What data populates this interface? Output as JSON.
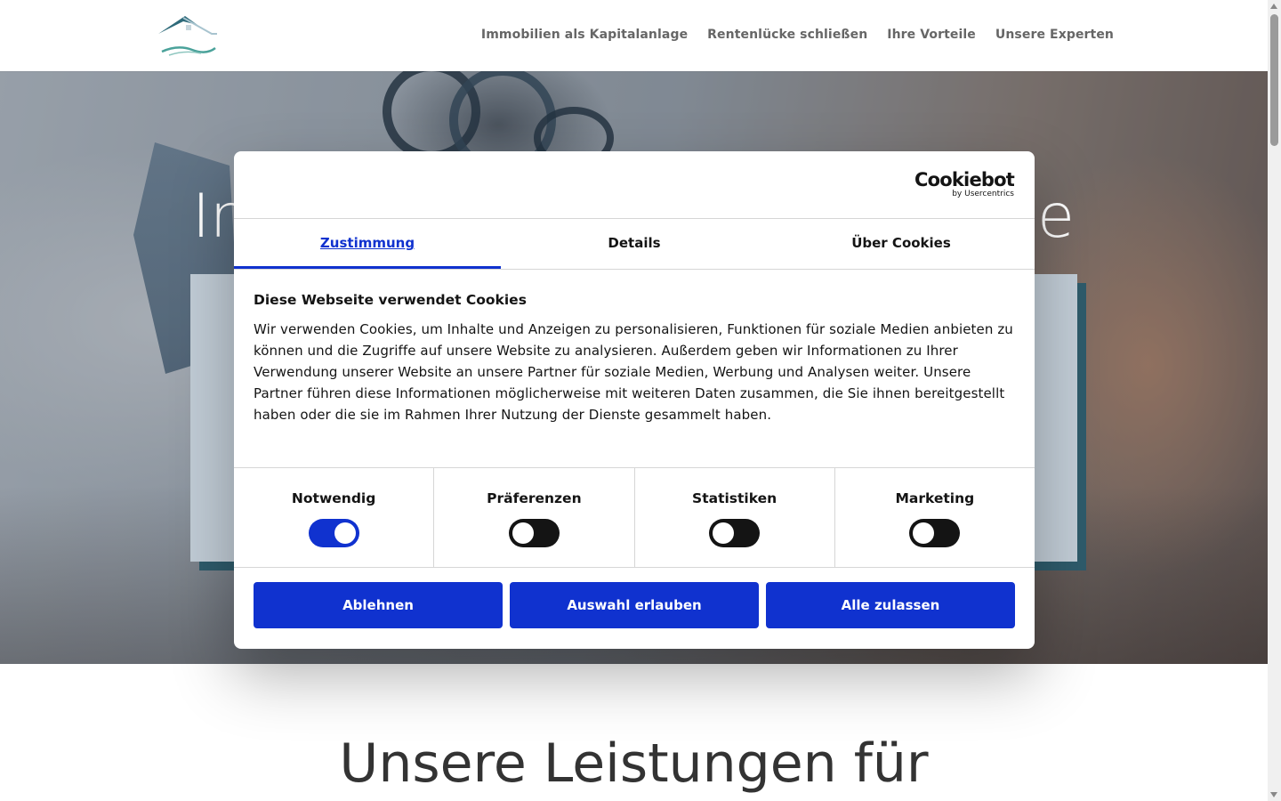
{
  "header": {
    "logo_name": "house-logo",
    "nav": [
      {
        "label": "Immobilien als Kapitalanlage"
      },
      {
        "label": "Rentenlücke schließen"
      },
      {
        "label": "Ihre Vorteile"
      },
      {
        "label": "Unsere Experten"
      }
    ]
  },
  "hero": {
    "title_left": "In",
    "title_right": "e"
  },
  "section": {
    "title": "Unsere Leistungen für"
  },
  "cookie": {
    "brand": "Cookiebot",
    "brand_sub": "by Usercentrics",
    "tabs": [
      {
        "label": "Zustimmung",
        "active": true
      },
      {
        "label": "Details",
        "active": false
      },
      {
        "label": "Über Cookies",
        "active": false
      }
    ],
    "heading": "Diese Webseite verwendet Cookies",
    "text": "Wir verwenden Cookies, um Inhalte und Anzeigen zu personalisieren, Funktionen für soziale Medien anbieten zu können und die Zugriffe auf unsere Website zu analysieren. Außerdem geben wir Informationen zu Ihrer Verwendung unserer Website an unsere Partner für soziale Medien, Werbung und Analysen weiter. Unsere Partner führen diese Informationen möglicherweise mit weiteren Daten zusammen, die Sie ihnen bereitgestellt haben oder die sie im Rahmen Ihrer Nutzung der Dienste gesammelt haben.",
    "categories": [
      {
        "label": "Notwendig",
        "enabled": true
      },
      {
        "label": "Präferenzen",
        "enabled": false
      },
      {
        "label": "Statistiken",
        "enabled": false
      },
      {
        "label": "Marketing",
        "enabled": false
      }
    ],
    "buttons": {
      "decline": "Ablehnen",
      "allow_selection": "Auswahl erlauben",
      "allow_all": "Alle zulassen"
    },
    "accent_color": "#1032cf"
  }
}
